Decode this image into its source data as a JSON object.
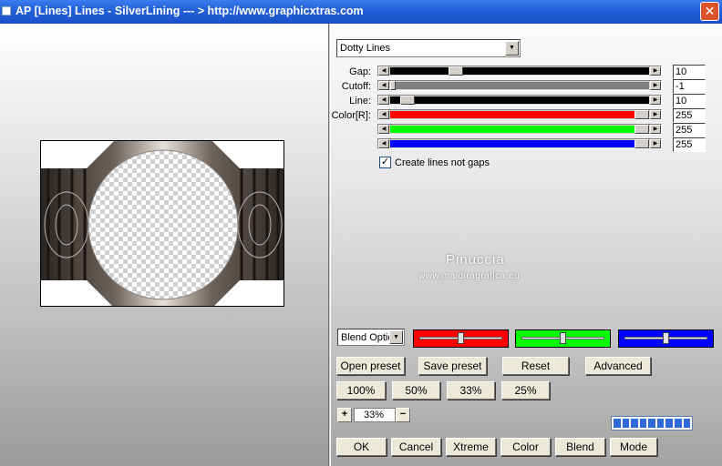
{
  "window": {
    "title": "AP [Lines]  Lines - SilverLining     --- > http://www.graphicxtras.com",
    "close_label": "✕"
  },
  "effect_select": {
    "value": "Dotty Lines"
  },
  "params": [
    {
      "label": "Gap:",
      "value": "10",
      "color": "#000000",
      "thumb_pct": 0.24
    },
    {
      "label": "Cutoff:",
      "value": "-1",
      "color": "#808080",
      "thumb_pct": null
    },
    {
      "label": "Line:",
      "value": "10",
      "color": "#000000",
      "thumb_pct": 0.04
    },
    {
      "label": "Color[R]:",
      "value": "255",
      "color": "#ff0000",
      "thumb_pct": 1.0
    },
    {
      "label": "",
      "value": "255",
      "color": "#00ff00",
      "thumb_pct": 1.0
    },
    {
      "label": "",
      "value": "255",
      "color": "#0000ff",
      "thumb_pct": 1.0
    }
  ],
  "checkbox": {
    "label": "Create lines not gaps",
    "checked": true,
    "mark": "✓"
  },
  "watermark": {
    "name": "Pinuccia",
    "site": "www.maidiragrafica.eu"
  },
  "blend_select": {
    "value": "Blend Optio"
  },
  "color_panels": [
    {
      "color": "#ff0000",
      "knob_pct": 0.5
    },
    {
      "color": "#00ff00",
      "knob_pct": 0.5
    },
    {
      "color": "#0000ff",
      "knob_pct": 0.5
    }
  ],
  "buttons": {
    "open_preset": "Open preset",
    "save_preset": "Save preset",
    "reset": "Reset",
    "advanced": "Advanced",
    "z100": "100%",
    "z50": "50%",
    "z33": "33%",
    "z25": "25%",
    "ok": "OK",
    "cancel": "Cancel",
    "xtreme": "Xtreme",
    "color": "Color",
    "blend": "Blend",
    "mode": "Mode"
  },
  "zoom": {
    "plus": "+",
    "value": "33%",
    "minus": "−"
  },
  "progress": {
    "segments": 9
  }
}
